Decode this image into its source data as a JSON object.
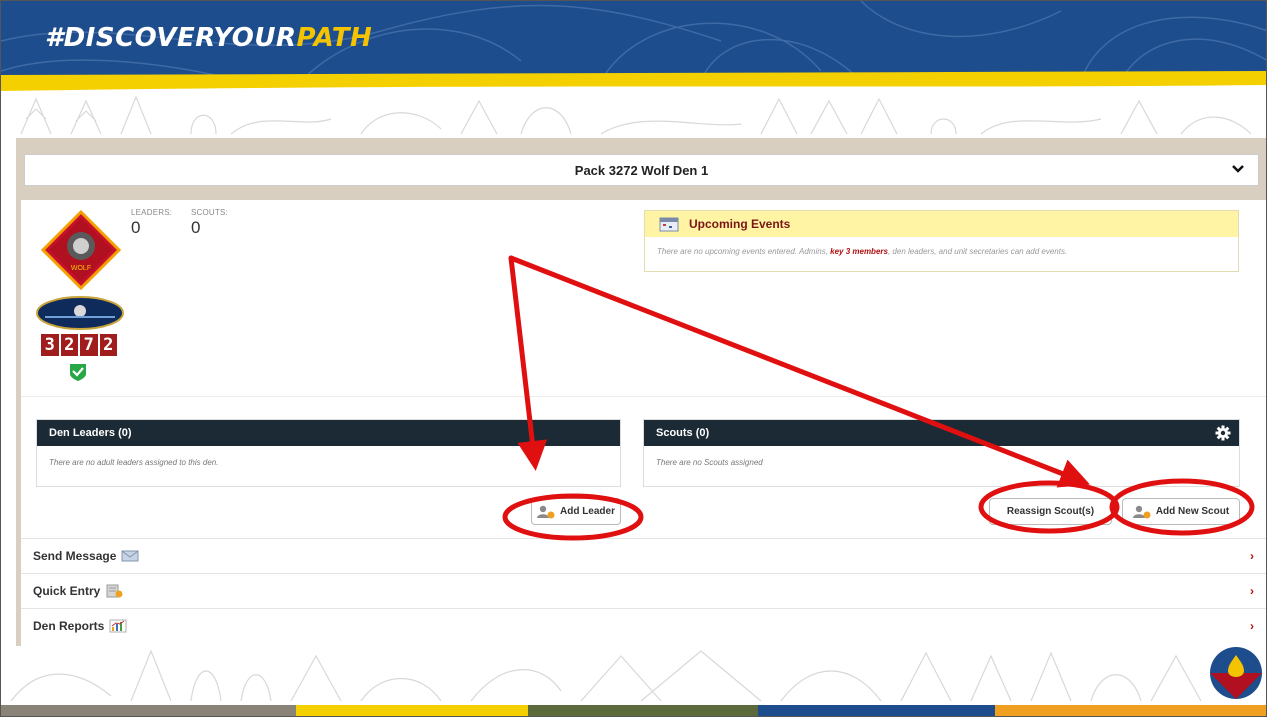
{
  "banner": {
    "hashtag_main": "#DISCOVERYOUR",
    "hashtag_accent": "PATH",
    "colors": {
      "blue": "#1d4d8c",
      "yellow": "#f4d000"
    }
  },
  "den_selector": {
    "title": "Pack 3272 Wolf Den 1",
    "icon": "chevron-down-icon"
  },
  "counts": {
    "leaders_label": "LEADERS:",
    "leaders_value": "0",
    "scouts_label": "SCOUTS:",
    "scouts_value": "0"
  },
  "unit": {
    "digits": [
      "3",
      "2",
      "7",
      "2"
    ]
  },
  "events": {
    "title": "Upcoming Events",
    "msg_before": "There are no upcoming events entered. Admins, ",
    "msg_bold": "key 3 members",
    "msg_after": ", den leaders, and unit secretaries can add events."
  },
  "den_leaders_panel": {
    "title": "Den Leaders (0)",
    "empty_msg": "There are no adult leaders assigned to this den."
  },
  "scouts_panel": {
    "title": "Scouts (0)",
    "empty_msg": "There are no Scouts assigned"
  },
  "buttons": {
    "add_leader": "Add Leader",
    "reassign_scouts": "Reassign Scout(s)",
    "add_new_scout": "Add New Scout"
  },
  "rows": {
    "send_message": "Send Message",
    "quick_entry": "Quick Entry",
    "den_reports": "Den Reports",
    "arrow": "›"
  },
  "bottom_strip_colors": [
    "#8a8478",
    "#f4d000",
    "#5c6a3c",
    "#1d4d8c",
    "#f0a020"
  ],
  "annotation_color": "#e01010"
}
